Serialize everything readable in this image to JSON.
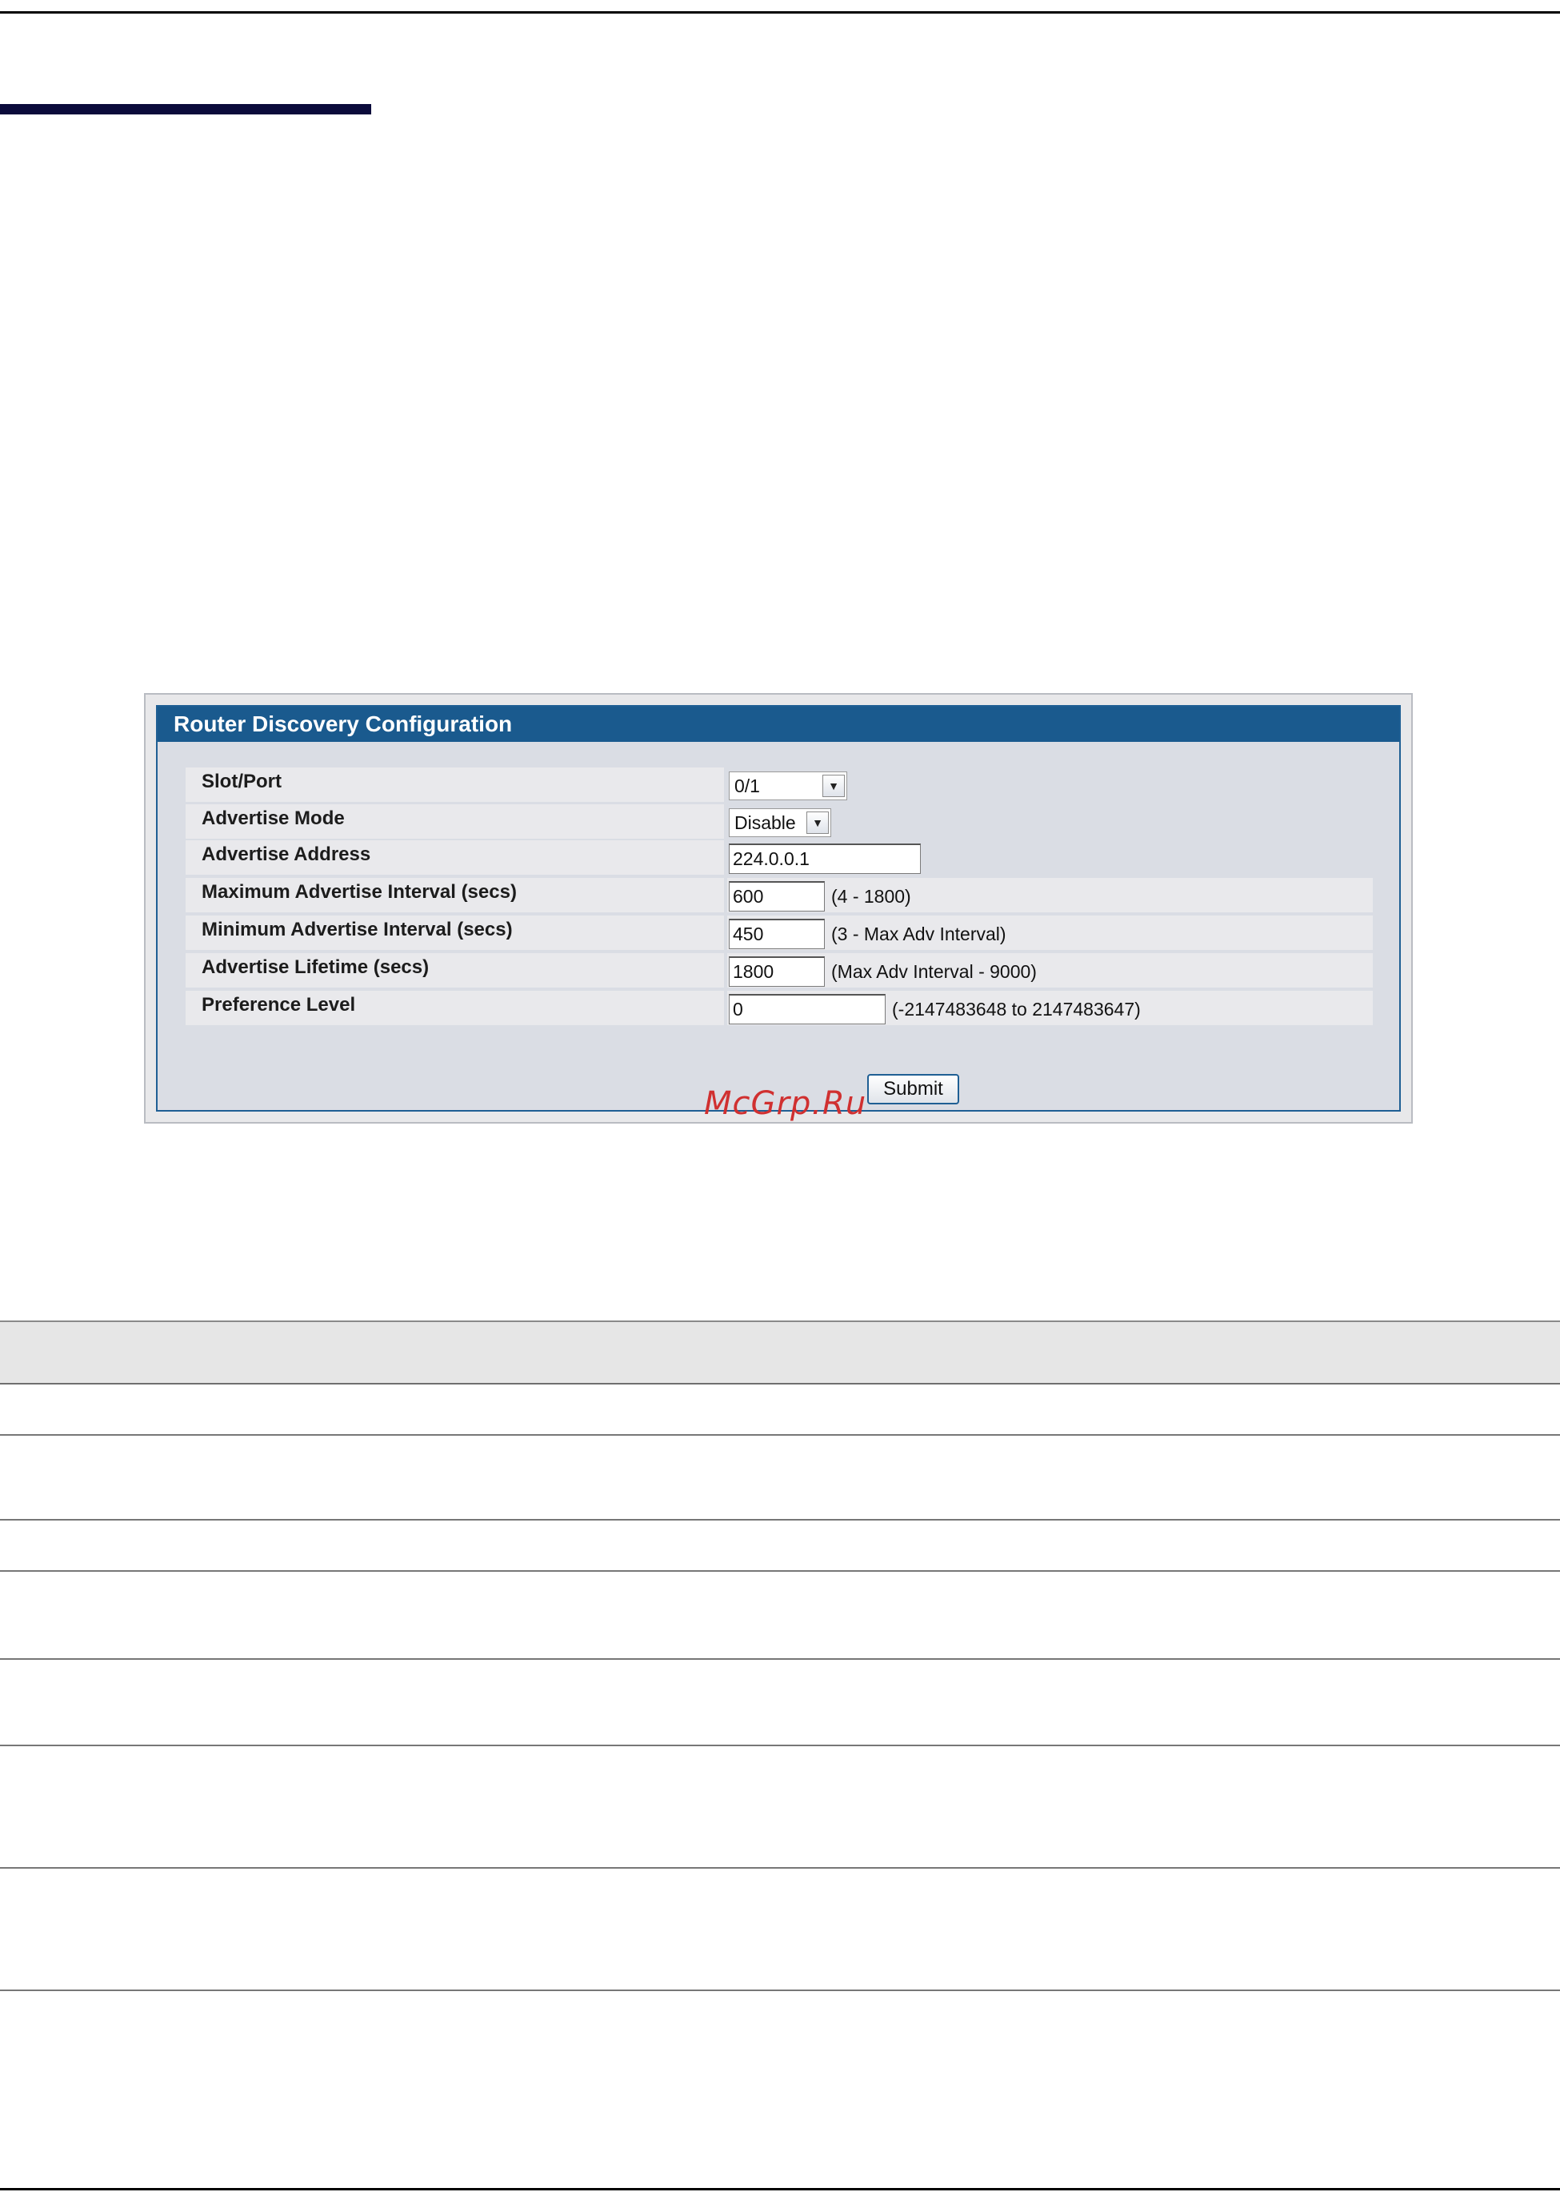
{
  "panel": {
    "title": "Router Discovery Configuration",
    "submit_label": "Submit"
  },
  "fields": {
    "slot_port": {
      "label": "Slot/Port",
      "value": "0/1"
    },
    "advertise_mode": {
      "label": "Advertise Mode",
      "value": "Disable"
    },
    "advertise_address": {
      "label": "Advertise Address",
      "value": "224.0.0.1"
    },
    "max_interval": {
      "label": "Maximum Advertise Interval (secs)",
      "value": "600",
      "hint": "(4 - 1800)"
    },
    "min_interval": {
      "label": "Minimum Advertise Interval (secs)",
      "value": "450",
      "hint": "(3 - Max Adv Interval)"
    },
    "lifetime": {
      "label": "Advertise Lifetime (secs)",
      "value": "1800",
      "hint": "(Max Adv Interval - 9000)"
    },
    "preference": {
      "label": "Preference Level",
      "value": "0",
      "hint": "(-2147483648 to 2147483647)"
    }
  },
  "watermark": "McGrp.Ru"
}
